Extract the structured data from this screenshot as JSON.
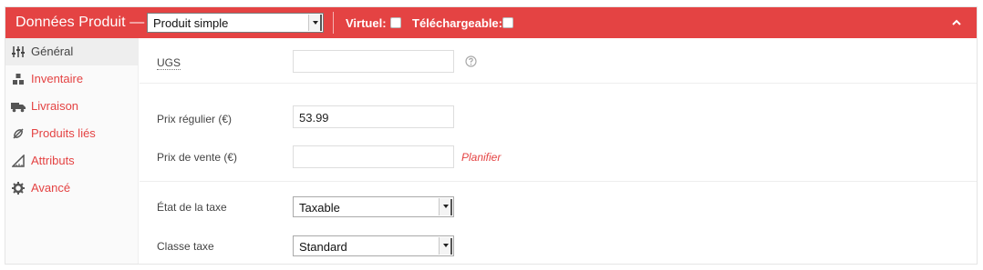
{
  "header": {
    "title": "Données Produit —",
    "product_type": {
      "selected": "Produit simple"
    },
    "virtual_label": "Virtuel:",
    "downloadable_label": "Téléchargeable:"
  },
  "tabs": [
    {
      "label": "Général",
      "icon": "sliders-icon",
      "active": true
    },
    {
      "label": "Inventaire",
      "icon": "boxes-icon"
    },
    {
      "label": "Livraison",
      "icon": "truck-icon"
    },
    {
      "label": "Produits liés",
      "icon": "link-icon"
    },
    {
      "label": "Attributs",
      "icon": "ruler-icon"
    },
    {
      "label": "Avancé",
      "icon": "gear-icon"
    }
  ],
  "fields": {
    "sku": {
      "label": "UGS",
      "value": ""
    },
    "regular_price": {
      "label": "Prix régulier (€)",
      "value": "53.99"
    },
    "sale_price": {
      "label": "Prix de vente (€)",
      "value": ""
    },
    "schedule_link": "Planifier",
    "tax_status": {
      "label": "État de la taxe",
      "selected": "Taxable"
    },
    "tax_class": {
      "label": "Classe taxe",
      "selected": "Standard"
    }
  },
  "colors": {
    "accent": "#e44343",
    "sidebar_bg": "#fafafa",
    "active_tab_bg": "#eeeeee"
  }
}
